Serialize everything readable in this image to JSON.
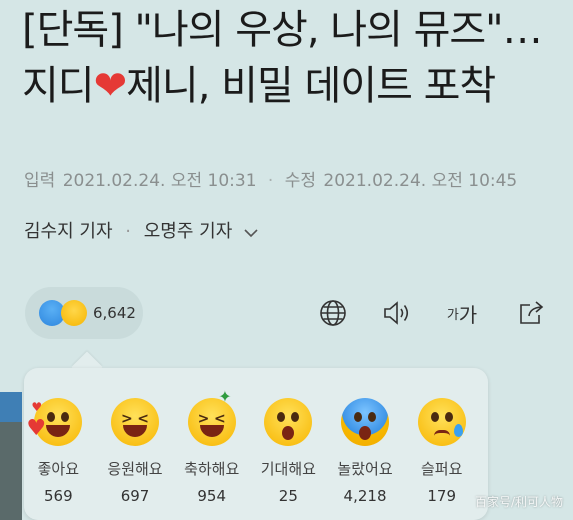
{
  "article": {
    "headline_part1": "[단독] \"나의 우상, 나의 뮤즈\"…지디",
    "headline_heart": "❤",
    "headline_part2": "제니, 비밀 데이트 포착",
    "posted_label": "입력",
    "posted_time": "2021.02.24. 오전 10:31",
    "updated_label": "수정",
    "updated_time": "2021.02.24. 오전 10:45",
    "author1": "김수지 기자",
    "author2": "오명주 기자"
  },
  "toolbar": {
    "reaction_total": "6,642",
    "font_label_small": "가",
    "font_label_large": "가"
  },
  "reactions": [
    {
      "label": "좋아요",
      "count": "569"
    },
    {
      "label": "응원해요",
      "count": "697"
    },
    {
      "label": "축하해요",
      "count": "954"
    },
    {
      "label": "기대해요",
      "count": "25"
    },
    {
      "label": "놀랐어요",
      "count": "4,218"
    },
    {
      "label": "슬퍼요",
      "count": "179"
    }
  ],
  "watermark": "百家号/利可人物",
  "icons": [
    "chevron-down-icon",
    "globe-icon",
    "speaker-icon",
    "share-icon"
  ]
}
